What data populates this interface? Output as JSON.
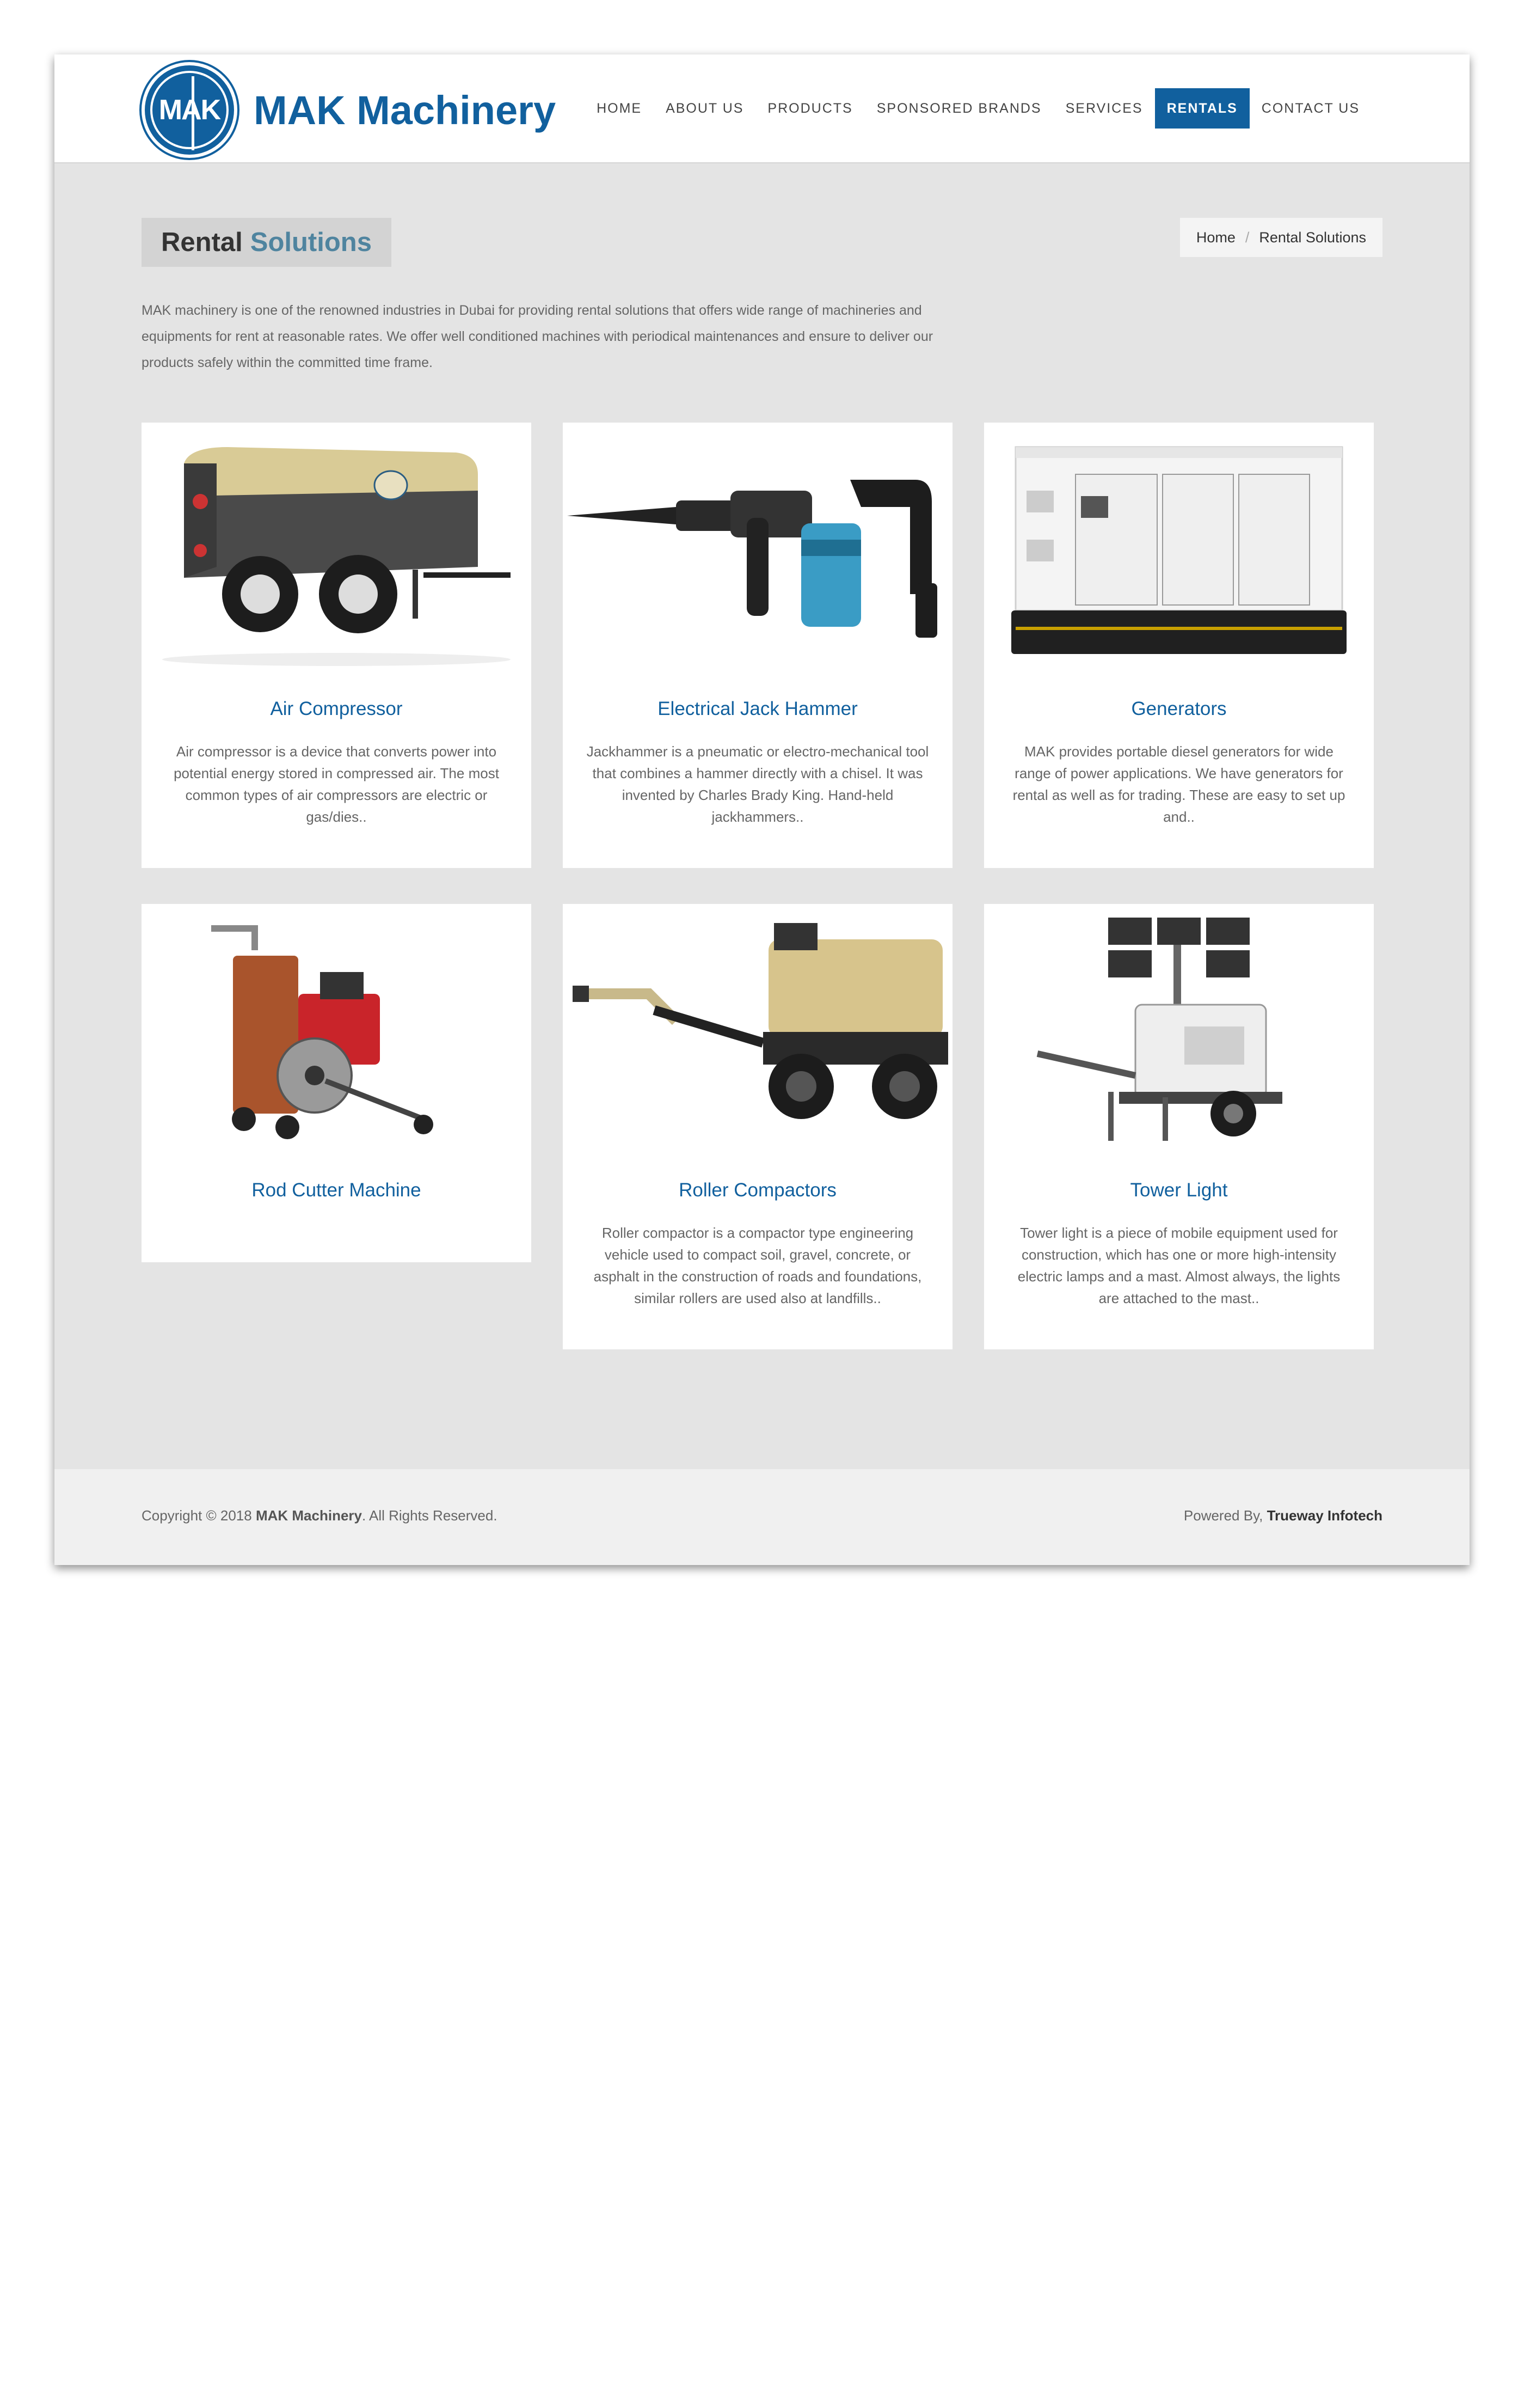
{
  "header": {
    "logo_mark": "MAK",
    "logo_text": "MAK Machinery",
    "nav": [
      {
        "label": "HOME"
      },
      {
        "label": "ABOUT US"
      },
      {
        "label": "PRODUCTS"
      },
      {
        "label": "SPONSORED BRANDS"
      },
      {
        "label": "SERVICES"
      },
      {
        "label": "RENTALS",
        "active": true
      },
      {
        "label": "CONTACT US"
      }
    ]
  },
  "page": {
    "title_part1": "Rental",
    "title_part2": "Solutions",
    "breadcrumb": {
      "home": "Home",
      "separator": "/",
      "current": "Rental Solutions"
    },
    "intro": "MAK machinery is one of the renowned industries in Dubai for providing rental solutions that offers wide range of machineries and equipments for rent at reasonable rates. We offer well conditioned machines with periodical maintenances and ensure to deliver our products safely within the committed time frame."
  },
  "cards": [
    {
      "title": "Air Compressor",
      "description": "Air compressor is a device that converts power into potential energy stored in compressed air. The most common types of air compressors are electric or gas/dies..",
      "icon": "air-compressor-image"
    },
    {
      "title": "Electrical Jack Hammer",
      "description": "Jackhammer is a pneumatic or electro-mechanical tool that combines a hammer directly with a chisel. It was invented by Charles Brady King. Hand-held jackhammers..",
      "icon": "jack-hammer-image"
    },
    {
      "title": "Generators",
      "description": "MAK provides portable diesel generators for wide range of power applications. We have generators for rental as well as for trading. These are easy to set up and..",
      "icon": "generator-image"
    },
    {
      "title": "Rod Cutter Machine",
      "description": "",
      "icon": "rod-cutter-image"
    },
    {
      "title": "Roller Compactors",
      "description": "Roller compactor is a compactor type engineering vehicle used to compact soil, gravel, concrete, or asphalt in the construction of roads and foundations, similar rollers are used also at landfills..",
      "icon": "roller-compactor-image"
    },
    {
      "title": "Tower Light",
      "description": "Tower light is a piece of mobile equipment used for construction, which has one or more high-intensity electric lamps and a mast. Almost always, the lights are attached to the mast..",
      "icon": "tower-light-image"
    }
  ],
  "footer": {
    "copyright_prefix": "Copyright © 2018",
    "company": "MAK Machinery",
    "copyright_suffix": ". All Rights Reserved.",
    "powered_prefix": "Powered By,",
    "powered_company": "Trueway Infotech"
  },
  "colors": {
    "brand_blue": "#11609e",
    "title_accent": "#4f849f",
    "page_bg": "#e4e4e4"
  }
}
